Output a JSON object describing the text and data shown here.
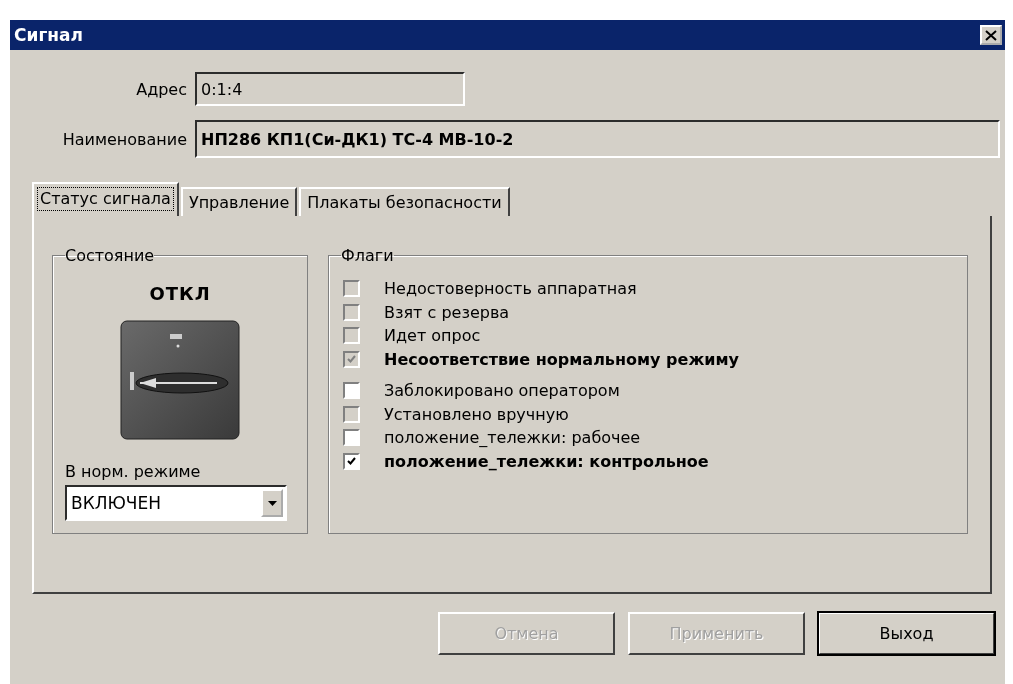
{
  "window": {
    "title": "Сигнал"
  },
  "address": {
    "label": "Адрес",
    "value": "0:1:4"
  },
  "name": {
    "label": "Наименование",
    "value": "НП286 КП1(Си-ДК1) ТС-4 МВ-10-2"
  },
  "tabs": [
    {
      "label": "Статус сигнала",
      "selected": true
    },
    {
      "label": "Управление",
      "selected": false
    },
    {
      "label": "Плакаты безопасности",
      "selected": false
    }
  ],
  "state": {
    "title": "Состояние",
    "value": "ОТКЛ",
    "normal_label": "В норм. режиме",
    "normal_value": "ВКЛЮЧЕН"
  },
  "flags": {
    "title": "Флаги",
    "items": [
      {
        "label": "Недостоверность аппаратная",
        "checked": false,
        "disabled": true,
        "bold": false
      },
      {
        "label": "Взят с резерва",
        "checked": false,
        "disabled": true,
        "bold": false
      },
      {
        "label": "Идет опрос",
        "checked": false,
        "disabled": true,
        "bold": false
      },
      {
        "label": "Несоответствие нормальному режиму",
        "checked": true,
        "disabled": true,
        "bold": true
      },
      {
        "label": "Заблокировано оператором",
        "checked": false,
        "disabled": false,
        "bold": false
      },
      {
        "label": "Установлено вручную",
        "checked": false,
        "disabled": true,
        "bold": false
      },
      {
        "label": "положение_тележки: рабочее",
        "checked": false,
        "disabled": false,
        "bold": false
      },
      {
        "label": "положение_тележки: контрольное",
        "checked": true,
        "disabled": false,
        "bold": true
      }
    ]
  },
  "buttons": [
    {
      "label": "Отмена",
      "disabled": true,
      "default": false
    },
    {
      "label": "Применить",
      "disabled": true,
      "default": false
    },
    {
      "label": "Выход",
      "disabled": false,
      "default": true
    }
  ]
}
